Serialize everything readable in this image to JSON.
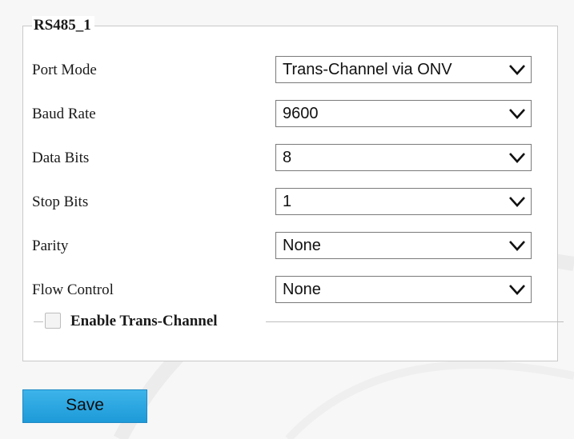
{
  "group": {
    "title": "RS485_1"
  },
  "fields": {
    "port_mode": {
      "label": "Port Mode",
      "value": "Trans-Channel via ONV"
    },
    "baud_rate": {
      "label": "Baud Rate",
      "value": "9600"
    },
    "data_bits": {
      "label": "Data Bits",
      "value": "8"
    },
    "stop_bits": {
      "label": "Stop Bits",
      "value": "1"
    },
    "parity": {
      "label": "Parity",
      "value": "None"
    },
    "flow_control": {
      "label": "Flow Control",
      "value": "None"
    }
  },
  "trans_channel": {
    "label": "Enable Trans-Channel",
    "checked": false
  },
  "actions": {
    "save_label": "Save"
  },
  "icons": {
    "dropdown": "chevron-down-icon",
    "checkbox": "checkbox-icon"
  },
  "colors": {
    "save_button": "#1d9ad8",
    "panel_border": "#c9c9c9",
    "background": "#f7f7f7"
  }
}
